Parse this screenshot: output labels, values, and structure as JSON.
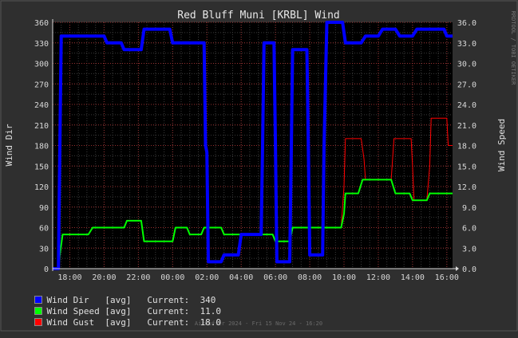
{
  "chart_data": {
    "type": "line",
    "title": "Red Bluff Muni [KRBL] Wind",
    "ylabel_left": "Wind Dir",
    "ylabel_right": "Wind Speed",
    "side_credit": "RRDTOOL / TOBI OETIKER",
    "footer": "AirPuffer 2024 - Fri 15 Nov 24 - 16:20",
    "colors": {
      "wind_dir": "#0000ff",
      "wind_speed": "#00ff00",
      "wind_gust": "#ff0000",
      "grid_major": "#b03030",
      "plot_bg": "#000000"
    },
    "x_range": [
      "2024-11-15 17:00",
      "2024-11-16 16:20"
    ],
    "x_ticks": [
      "18:00",
      "20:00",
      "22:00",
      "00:00",
      "02:00",
      "04:00",
      "06:00",
      "08:00",
      "10:00",
      "12:00",
      "14:00",
      "16:00"
    ],
    "y_left_range": [
      0,
      360
    ],
    "y_left_ticks": [
      "0",
      "30",
      "60",
      "90",
      "120",
      "150",
      "180",
      "210",
      "240",
      "270",
      "300",
      "330",
      "360"
    ],
    "y_right_range": [
      0,
      36
    ],
    "y_right_ticks": [
      "0.0",
      "3.0",
      "6.0",
      "9.0",
      "12.0",
      "15.0",
      "18.0",
      "21.0",
      "24.0",
      "27.0",
      "30.0",
      "33.0",
      "36.0"
    ],
    "grid": true,
    "series": [
      {
        "name": "Wind Dir",
        "axis": "left",
        "points": [
          [
            "2024-11-15 17:00",
            0
          ],
          [
            "2024-11-15 17:20",
            0
          ],
          [
            "2024-11-15 17:25",
            170
          ],
          [
            "2024-11-15 17:30",
            340
          ],
          [
            "2024-11-15 20:00",
            340
          ],
          [
            "2024-11-15 20:10",
            330
          ],
          [
            "2024-11-15 21:00",
            330
          ],
          [
            "2024-11-15 21:10",
            320
          ],
          [
            "2024-11-15 22:10",
            320
          ],
          [
            "2024-11-15 22:20",
            350
          ],
          [
            "2024-11-15 23:50",
            350
          ],
          [
            "2024-11-16 00:00",
            330
          ],
          [
            "2024-11-16 01:50",
            330
          ],
          [
            "2024-11-16 01:55",
            180
          ],
          [
            "2024-11-16 02:00",
            170
          ],
          [
            "2024-11-16 02:05",
            10
          ],
          [
            "2024-11-16 02:50",
            10
          ],
          [
            "2024-11-16 03:00",
            20
          ],
          [
            "2024-11-16 03:50",
            20
          ],
          [
            "2024-11-16 04:00",
            50
          ],
          [
            "2024-11-16 05:10",
            50
          ],
          [
            "2024-11-16 05:15",
            180
          ],
          [
            "2024-11-16 05:20",
            330
          ],
          [
            "2024-11-16 05:55",
            330
          ],
          [
            "2024-11-16 06:00",
            180
          ],
          [
            "2024-11-16 06:05",
            10
          ],
          [
            "2024-11-16 06:50",
            10
          ],
          [
            "2024-11-16 06:55",
            160
          ],
          [
            "2024-11-16 07:00",
            320
          ],
          [
            "2024-11-16 07:50",
            320
          ],
          [
            "2024-11-16 07:55",
            180
          ],
          [
            "2024-11-16 08:00",
            20
          ],
          [
            "2024-11-16 08:45",
            20
          ],
          [
            "2024-11-16 08:50",
            180
          ],
          [
            "2024-11-16 09:00",
            360
          ],
          [
            "2024-11-16 09:55",
            360
          ],
          [
            "2024-11-16 10:05",
            330
          ],
          [
            "2024-11-16 11:00",
            330
          ],
          [
            "2024-11-16 11:15",
            340
          ],
          [
            "2024-11-16 12:00",
            340
          ],
          [
            "2024-11-16 12:15",
            350
          ],
          [
            "2024-11-16 13:00",
            350
          ],
          [
            "2024-11-16 13:15",
            340
          ],
          [
            "2024-11-16 14:00",
            340
          ],
          [
            "2024-11-16 14:15",
            350
          ],
          [
            "2024-11-16 15:50",
            350
          ],
          [
            "2024-11-16 16:00",
            340
          ],
          [
            "2024-11-16 16:20",
            340
          ]
        ]
      },
      {
        "name": "Wind Speed",
        "axis": "right",
        "points": [
          [
            "2024-11-15 17:00",
            0
          ],
          [
            "2024-11-15 17:20",
            0
          ],
          [
            "2024-11-15 17:25",
            2
          ],
          [
            "2024-11-15 17:35",
            5
          ],
          [
            "2024-11-15 19:05",
            5
          ],
          [
            "2024-11-15 19:20",
            6
          ],
          [
            "2024-11-15 21:10",
            6
          ],
          [
            "2024-11-15 21:20",
            7
          ],
          [
            "2024-11-15 22:10",
            7
          ],
          [
            "2024-11-15 22:20",
            4
          ],
          [
            "2024-11-16 00:00",
            4
          ],
          [
            "2024-11-16 00:10",
            6
          ],
          [
            "2024-11-16 00:50",
            6
          ],
          [
            "2024-11-16 01:00",
            5
          ],
          [
            "2024-11-16 01:40",
            5
          ],
          [
            "2024-11-16 01:50",
            6
          ],
          [
            "2024-11-16 02:50",
            6
          ],
          [
            "2024-11-16 03:00",
            5
          ],
          [
            "2024-11-16 05:50",
            5
          ],
          [
            "2024-11-16 06:00",
            4
          ],
          [
            "2024-11-16 06:50",
            4
          ],
          [
            "2024-11-16 07:00",
            6
          ],
          [
            "2024-11-16 09:50",
            6
          ],
          [
            "2024-11-16 10:00",
            8
          ],
          [
            "2024-11-16 10:05",
            11
          ],
          [
            "2024-11-16 10:50",
            11
          ],
          [
            "2024-11-16 11:05",
            13
          ],
          [
            "2024-11-16 12:45",
            13
          ],
          [
            "2024-11-16 13:00",
            11
          ],
          [
            "2024-11-16 13:50",
            11
          ],
          [
            "2024-11-16 14:00",
            10
          ],
          [
            "2024-11-16 14:50",
            10
          ],
          [
            "2024-11-16 15:00",
            11
          ],
          [
            "2024-11-16 16:20",
            11
          ]
        ]
      },
      {
        "name": "Wind Gust",
        "axis": "right",
        "points": [
          [
            "2024-11-16 09:50",
            6
          ],
          [
            "2024-11-16 10:00",
            12
          ],
          [
            "2024-11-16 10:05",
            19
          ],
          [
            "2024-11-16 11:00",
            19
          ],
          [
            "2024-11-16 11:10",
            16
          ],
          [
            "2024-11-16 11:15",
            13
          ],
          [
            "2024-11-16 12:45",
            13
          ],
          [
            "2024-11-16 12:55",
            19
          ],
          [
            "2024-11-16 13:55",
            19
          ],
          [
            "2024-11-16 14:00",
            15
          ],
          [
            "2024-11-16 14:05",
            10
          ],
          [
            "2024-11-16 14:50",
            10
          ],
          [
            "2024-11-16 15:00",
            15
          ],
          [
            "2024-11-16 15:05",
            22
          ],
          [
            "2024-11-16 16:00",
            22
          ],
          [
            "2024-11-16 16:05",
            18
          ],
          [
            "2024-11-16 16:20",
            18
          ]
        ]
      }
    ],
    "legend": [
      {
        "label": "Wind Dir   [avg]   Current:",
        "value": "340"
      },
      {
        "label": "Wind Speed [avg]   Current:",
        "value": "11.0"
      },
      {
        "label": "Wind Gust  [avg]   Current:",
        "value": "18.0"
      }
    ]
  }
}
